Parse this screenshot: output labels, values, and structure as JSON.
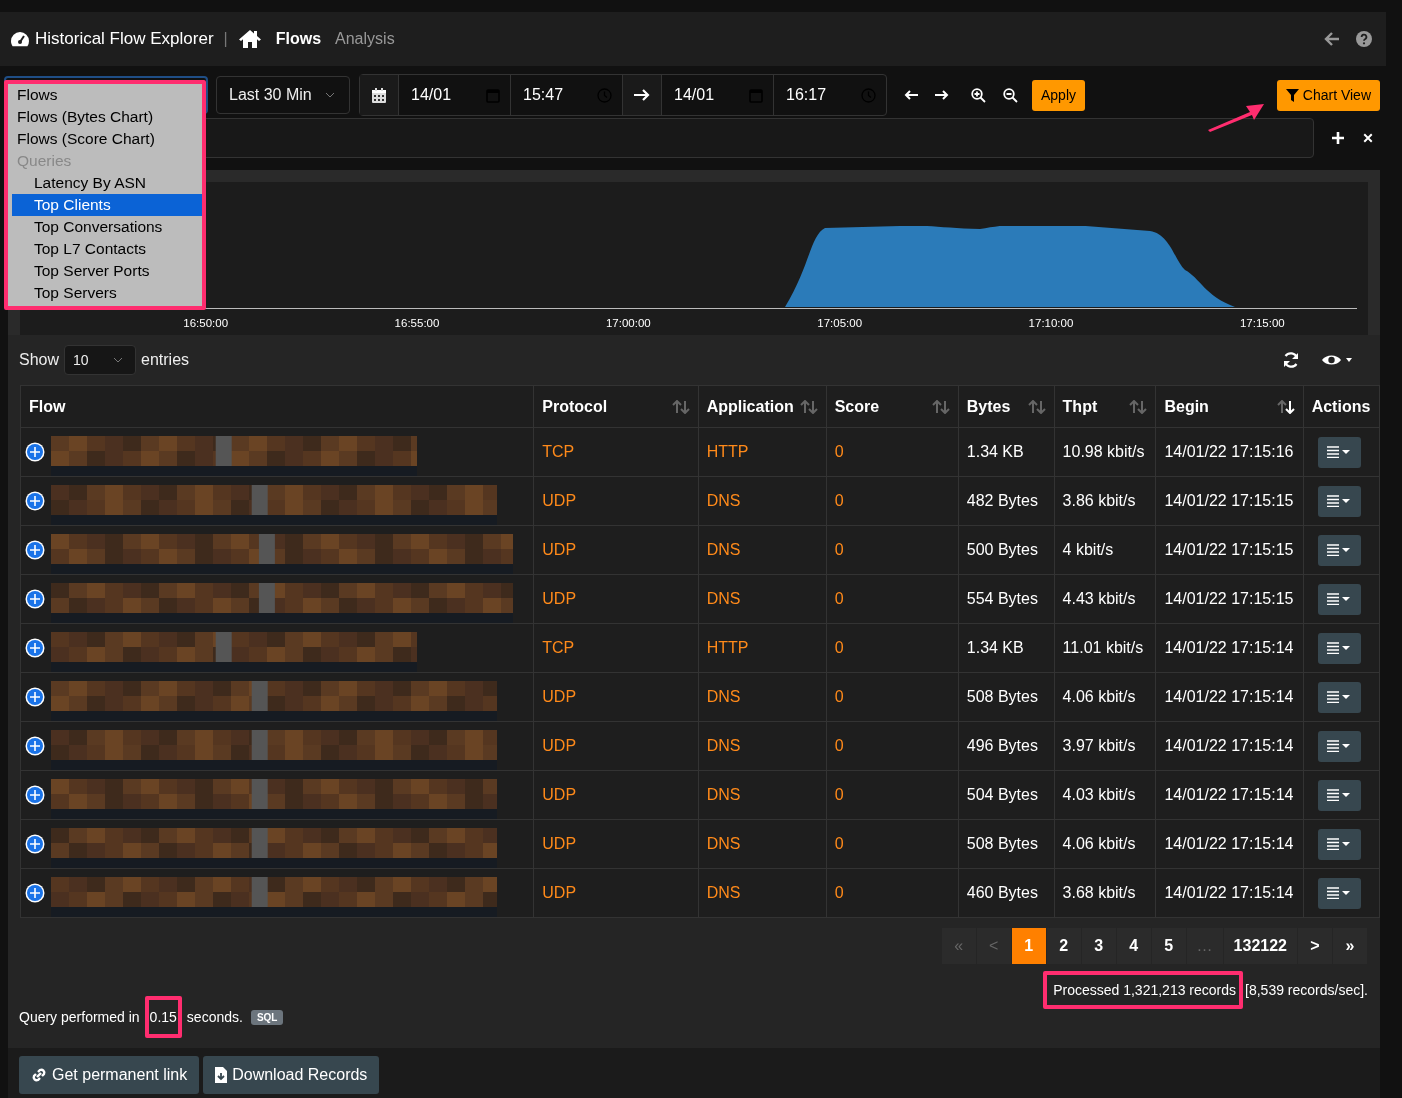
{
  "navbar": {
    "title": "Historical Flow Explorer",
    "separator": "|",
    "links": [
      {
        "label": "Flows",
        "selected": true
      },
      {
        "label": "Analysis",
        "selected": false
      }
    ]
  },
  "toolbar": {
    "range": "Last 30 Min",
    "from_date": "14/01",
    "from_time": "15:47",
    "to_date": "14/01",
    "to_time": "16:17",
    "apply": "Apply",
    "chart_view": "Chart View"
  },
  "query_menu": {
    "options": [
      {
        "label": "Flows",
        "kind": "option",
        "selected": false
      },
      {
        "label": "Flows (Bytes Chart)",
        "kind": "option",
        "selected": false
      },
      {
        "label": "Flows (Score Chart)",
        "kind": "option",
        "selected": false
      },
      {
        "label": "Queries",
        "kind": "group",
        "children": [
          {
            "label": "Latency By ASN",
            "kind": "option",
            "selected": false
          },
          {
            "label": "Top Clients",
            "kind": "option",
            "selected": true
          },
          {
            "label": "Top Conversations",
            "kind": "option",
            "selected": false
          },
          {
            "label": "Top L7 Contacts",
            "kind": "option",
            "selected": false
          },
          {
            "label": "Top Server Ports",
            "kind": "option",
            "selected": false
          },
          {
            "label": "Top Servers",
            "kind": "option",
            "selected": false
          }
        ]
      }
    ]
  },
  "chart": {
    "x_labels": [
      "16:50:00",
      "16:55:00",
      "17:00:00",
      "17:05:00",
      "17:10:00",
      "17:15:00"
    ]
  },
  "entries": {
    "before": "Show",
    "value": "10",
    "after": "entries"
  },
  "table": {
    "columns": [
      {
        "label": "Flow"
      },
      {
        "label": "Protocol",
        "sorted": false
      },
      {
        "label": "Application",
        "sorted": false
      },
      {
        "label": "Score",
        "sorted": false
      },
      {
        "label": "Bytes",
        "sorted": false
      },
      {
        "label": "Thpt",
        "sorted": false
      },
      {
        "label": "Begin",
        "sorted": true
      },
      {
        "label": "Actions"
      }
    ],
    "rows": [
      {
        "protocol": "TCP",
        "application": "HTTP",
        "score": "0",
        "bytes": "1.34 KB",
        "thpt": "10.98 kbit/s",
        "begin": "14/01/22 17:15:16"
      },
      {
        "protocol": "UDP",
        "application": "DNS",
        "score": "0",
        "bytes": "482 Bytes",
        "thpt": "3.86 kbit/s",
        "begin": "14/01/22 17:15:15"
      },
      {
        "protocol": "UDP",
        "application": "DNS",
        "score": "0",
        "bytes": "500 Bytes",
        "thpt": "4 kbit/s",
        "begin": "14/01/22 17:15:15"
      },
      {
        "protocol": "UDP",
        "application": "DNS",
        "score": "0",
        "bytes": "554 Bytes",
        "thpt": "4.43 kbit/s",
        "begin": "14/01/22 17:15:15"
      },
      {
        "protocol": "TCP",
        "application": "HTTP",
        "score": "0",
        "bytes": "1.34 KB",
        "thpt": "11.01 kbit/s",
        "begin": "14/01/22 17:15:14"
      },
      {
        "protocol": "UDP",
        "application": "DNS",
        "score": "0",
        "bytes": "508 Bytes",
        "thpt": "4.06 kbit/s",
        "begin": "14/01/22 17:15:14"
      },
      {
        "protocol": "UDP",
        "application": "DNS",
        "score": "0",
        "bytes": "496 Bytes",
        "thpt": "3.97 kbit/s",
        "begin": "14/01/22 17:15:14"
      },
      {
        "protocol": "UDP",
        "application": "DNS",
        "score": "0",
        "bytes": "504 Bytes",
        "thpt": "4.03 kbit/s",
        "begin": "14/01/22 17:15:14"
      },
      {
        "protocol": "UDP",
        "application": "DNS",
        "score": "0",
        "bytes": "508 Bytes",
        "thpt": "4.06 kbit/s",
        "begin": "14/01/22 17:15:14"
      },
      {
        "protocol": "UDP",
        "application": "DNS",
        "score": "0",
        "bytes": "460 Bytes",
        "thpt": "3.68 kbit/s",
        "begin": "14/01/22 17:15:14"
      }
    ]
  },
  "pagination": [
    {
      "label": "«",
      "selected": false,
      "disabled": true
    },
    {
      "label": "<",
      "selected": false,
      "disabled": true
    },
    {
      "label": "1",
      "selected": true,
      "disabled": false
    },
    {
      "label": "2",
      "selected": false,
      "disabled": false
    },
    {
      "label": "3",
      "selected": false,
      "disabled": false
    },
    {
      "label": "4",
      "selected": false,
      "disabled": false
    },
    {
      "label": "5",
      "selected": false,
      "disabled": false
    },
    {
      "label": "…",
      "selected": false,
      "disabled": true
    },
    {
      "label": "132122",
      "selected": false,
      "disabled": false
    },
    {
      "label": ">",
      "selected": false,
      "disabled": false
    },
    {
      "label": "»",
      "selected": false,
      "disabled": false
    }
  ],
  "processed": {
    "highlighted": "Processed 1,321,213 records",
    "rest": "[8,539 records/sec]."
  },
  "query_time": {
    "before": "Query performed in",
    "highlighted": "0.15",
    "after": "seconds.",
    "badge": "SQL"
  },
  "footer_buttons": [
    {
      "label": "Get permanent link",
      "kind": "link"
    },
    {
      "label": "Download Records",
      "kind": "download"
    }
  ]
}
